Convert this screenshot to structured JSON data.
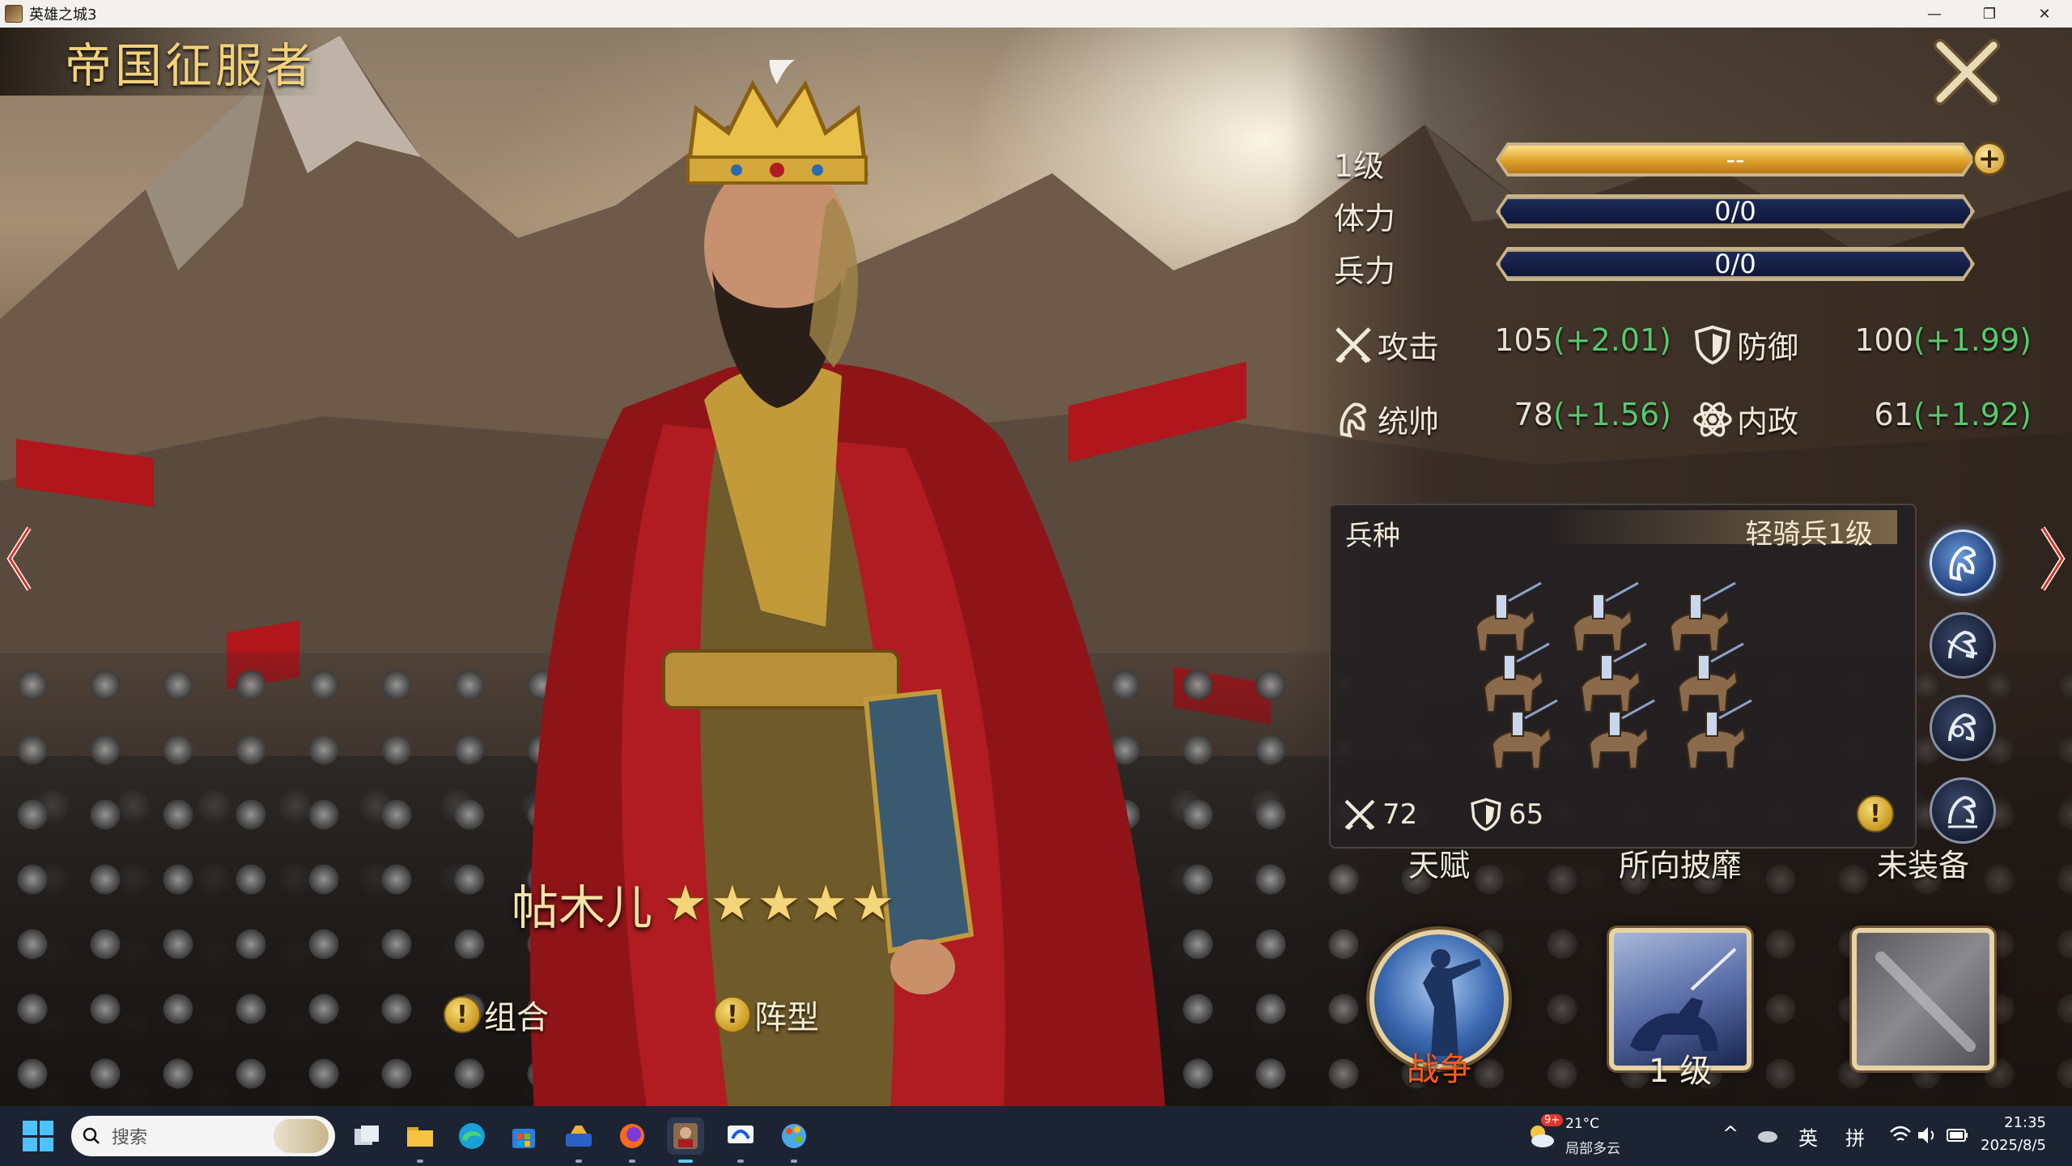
{
  "window": {
    "title": "英雄之城3",
    "minimize": "—",
    "maximize": "❐",
    "close": "✕"
  },
  "game": {
    "title": "帝国征服者",
    "hero": {
      "name": "帖木儿",
      "stars": 5,
      "star_glyph": "★"
    },
    "links": {
      "combo": "组合",
      "formation": "阵型",
      "warn_glyph": "!"
    },
    "stats": {
      "level_label": "1级",
      "level_bar_text": "--",
      "level_plus": "+",
      "stamina_label": "体力",
      "stamina_value": "0/0",
      "troops_label": "兵力",
      "troops_value": "0/0"
    },
    "attributes": [
      {
        "label": "攻击",
        "value": "105",
        "bonus": "(+2.01)",
        "icon": "swords-icon"
      },
      {
        "label": "防御",
        "value": "100",
        "bonus": "(+1.99)",
        "icon": "shield-icon"
      },
      {
        "label": "统帅",
        "value": "78",
        "bonus": "(+1.56)",
        "icon": "cavalry-icon"
      },
      {
        "label": "内政",
        "value": "61",
        "bonus": "(+1.92)",
        "icon": "atom-icon"
      }
    ],
    "troop": {
      "header": "兵种",
      "type": "轻骑兵1级",
      "attack": "72",
      "defense": "65",
      "type_buttons": [
        "cavalry-light-icon",
        "cavalry-archer-icon",
        "cavalry-heavy-icon",
        "cavalry-elite-icon"
      ]
    },
    "skills": {
      "talent_head": "天赋",
      "talent_name": "战争",
      "skill_head": "所向披靡",
      "skill_level": "1 级",
      "equip_head": "未装备"
    },
    "colors": {
      "gold_text": "#f4d27a",
      "bonus_green": "#57c96b",
      "talent_orange": "#ff5a1e"
    }
  },
  "taskbar": {
    "search_placeholder": "搜索",
    "weather_badge": "9+",
    "weather_temp": "21°C",
    "weather_desc": "局部多云",
    "ime_lang": "英",
    "ime_mode": "拼",
    "tray_caret": "^",
    "time": "21:35",
    "date": "2025/8/5"
  }
}
